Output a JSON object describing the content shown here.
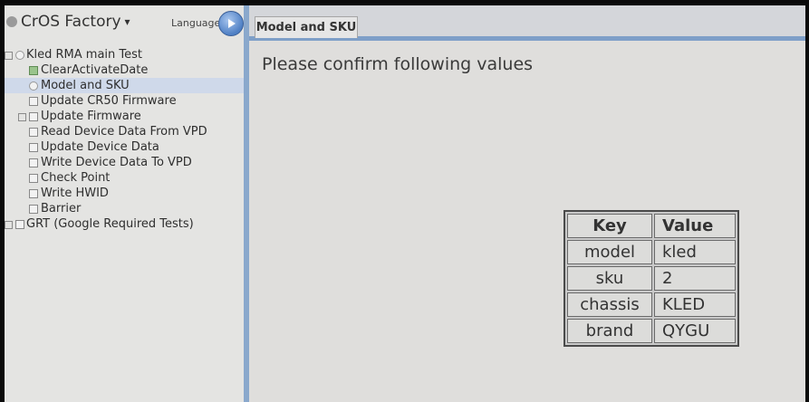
{
  "app": {
    "title": "CrOS Factory",
    "dropdown_glyph": "▾",
    "language_label": "Language"
  },
  "tree": {
    "root": "Kled RMA main Test",
    "items": [
      {
        "label": "ClearActivateDate"
      },
      {
        "label": "Model and SKU"
      },
      {
        "label": "Update CR50 Firmware"
      },
      {
        "label": "Update Firmware"
      },
      {
        "label": "Read Device Data From VPD"
      },
      {
        "label": "Update Device Data"
      },
      {
        "label": "Write Device Data To VPD"
      },
      {
        "label": "Check Point"
      },
      {
        "label": "Write HWID"
      },
      {
        "label": "Barrier"
      }
    ],
    "other_root": "GRT (Google Required Tests)"
  },
  "tab": {
    "label": "Model and SKU"
  },
  "main": {
    "prompt": "Please confirm following values",
    "table": {
      "headers": [
        "Key",
        "Value"
      ],
      "rows": [
        [
          "model",
          "kled"
        ],
        [
          "sku",
          "2"
        ],
        [
          "chassis",
          "KLED"
        ],
        [
          "brand",
          "QYGU"
        ]
      ]
    }
  },
  "colors": {
    "accent": "#7e9fc8",
    "active_test": "#9ac48c"
  }
}
